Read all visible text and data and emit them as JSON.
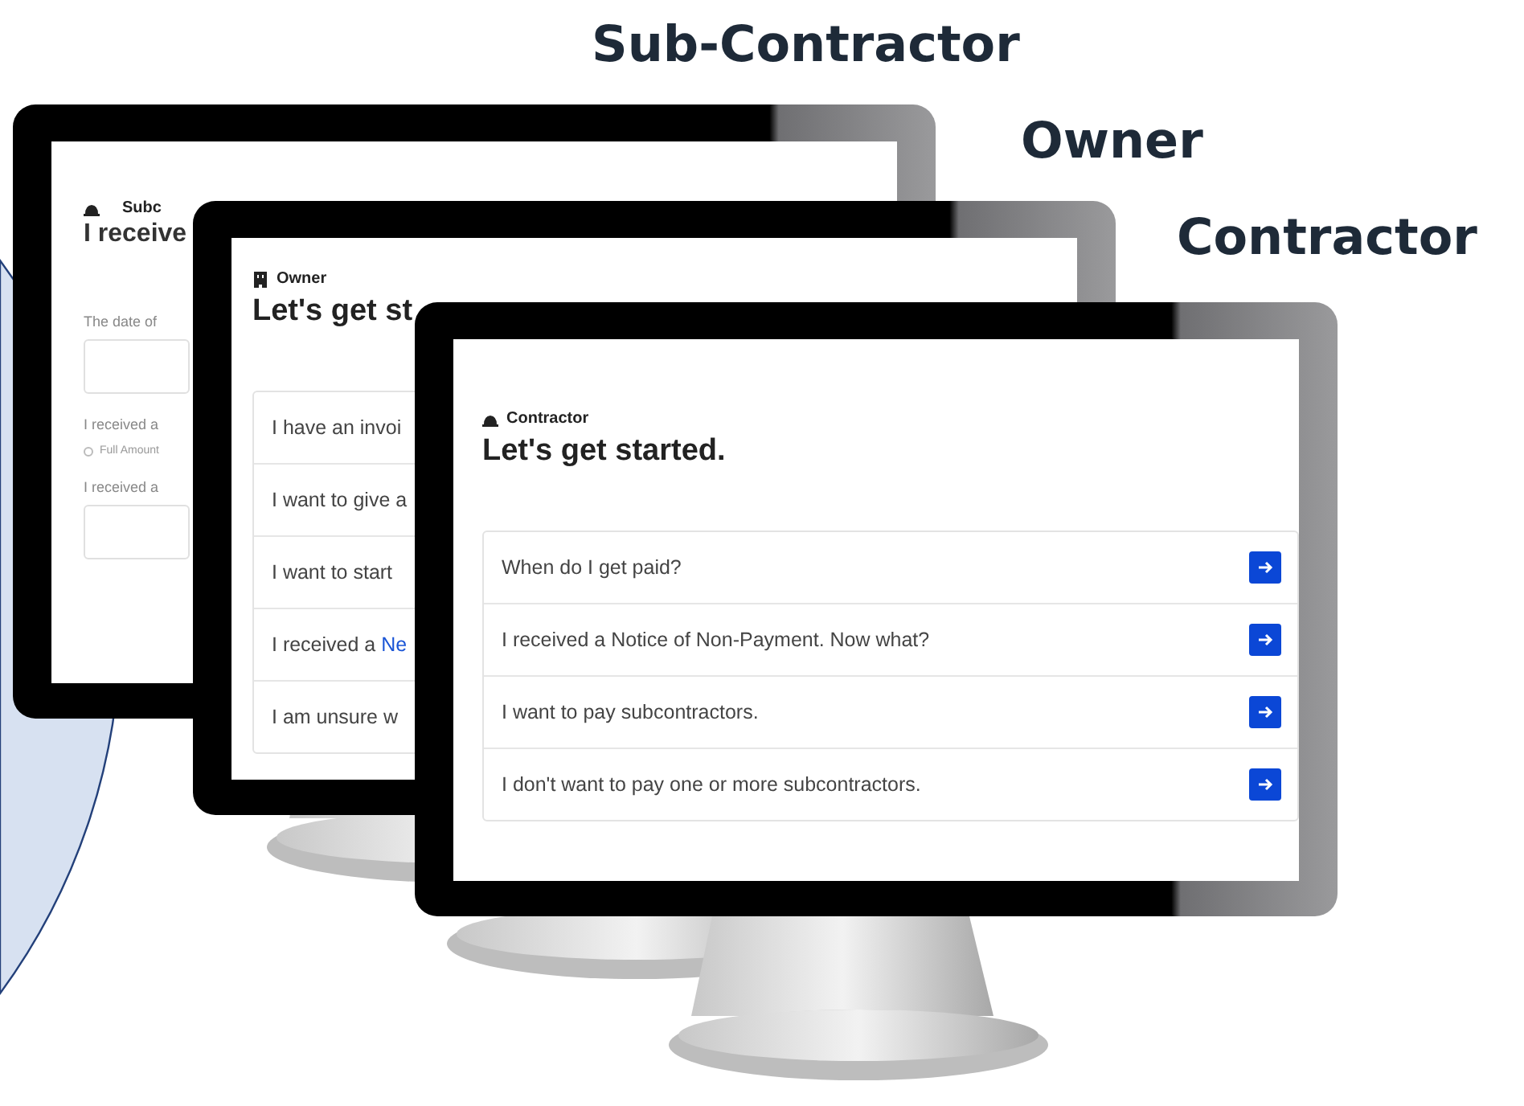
{
  "labels": [
    "Sub-Contractor",
    "Owner",
    "Contractor"
  ],
  "monitors": [
    {
      "kind": "form",
      "role": "Subc",
      "heading": "I receive",
      "items": [
        {
          "kind": "label",
          "text": "The date of"
        },
        {
          "kind": "field"
        },
        {
          "kind": "label",
          "text": "I received a"
        },
        {
          "kind": "radio",
          "text": "Full Amount",
          "selected": false
        },
        {
          "kind": "label",
          "text": "I received a"
        },
        {
          "kind": "field"
        }
      ]
    },
    {
      "kind": "menu",
      "role": "Owner",
      "heading": "Let's get st",
      "rows": [
        {
          "text": "I have an invoi"
        },
        {
          "text": "I want to give a"
        },
        {
          "text": "I want to start"
        },
        {
          "text": "I received a ",
          "link": "Ne"
        },
        {
          "text": "I am unsure w"
        }
      ]
    },
    {
      "kind": "menu",
      "role": "Contractor",
      "heading": "Let's get started.",
      "rows": [
        {
          "text": "When do I get paid?",
          "button": true
        },
        {
          "text": "I received a Notice of Non-Payment. Now what?",
          "button": true
        },
        {
          "text": "I want to pay subcontractors.",
          "button": true
        },
        {
          "text": "I don't want to pay one or more subcontractors.",
          "button": true
        }
      ]
    }
  ]
}
